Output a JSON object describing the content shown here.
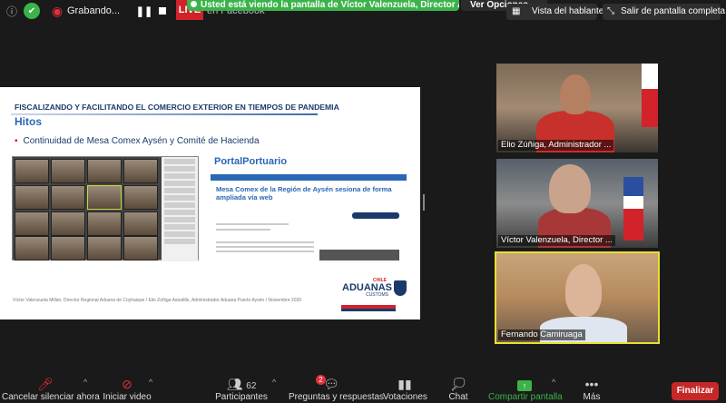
{
  "topbar": {
    "recording_label": "Grabando...",
    "live_label": "LIVE",
    "live_platform": "en Facebook",
    "share_banner": "Usted está viendo la pantalla de Víctor Valenzuela, Director Ad...",
    "view_options": "Ver Opciones",
    "speaker_view": "Vista del hablante",
    "exit_fullscreen": "Salir de pantalla completa"
  },
  "slide": {
    "title": "FISCALIZANDO Y FACILITANDO EL COMERCIO EXTERIOR EN TIEMPOS DE PANDEMIA",
    "heading": "Hitos",
    "bullet": "Continuidad de Mesa Comex Aysén y Comité de Hacienda",
    "portal_logo": "PortalPortuario",
    "portal_headline": "Mesa Comex de la Región de Aysén sesiona de forma ampliada vía web",
    "footer": "Víctor Valenzuela Millán, Director Regional Aduana de Coyhaique / Elio Zúñiga Astudillo, Administrador Aduana Puerto Aysén / Noviembre 2020",
    "logo_chile": "CHILE",
    "logo_main": "ADUANAS",
    "logo_sub": "CUSTOMS"
  },
  "participants_tiles": [
    {
      "name": "Elio Zúñiga, Administrador ..."
    },
    {
      "name": "Víctor Valenzuela, Director ..."
    },
    {
      "name": "Fernando Camiruaga"
    }
  ],
  "bottombar": {
    "mute": "Cancelar silenciar ahora",
    "video": "Iniciar video",
    "participants": "Participantes",
    "participants_count": "62",
    "qa": "Preguntas y respuestas",
    "qa_badge": "2",
    "polls": "Votaciones",
    "chat": "Chat",
    "share": "Compartir pantalla",
    "more": "Más",
    "end": "Finalizar"
  },
  "colors": {
    "share_green": "#3bb34a",
    "end_red": "#c62828",
    "active_speaker": "#e6e031",
    "slide_blue": "#1b3a6b"
  }
}
